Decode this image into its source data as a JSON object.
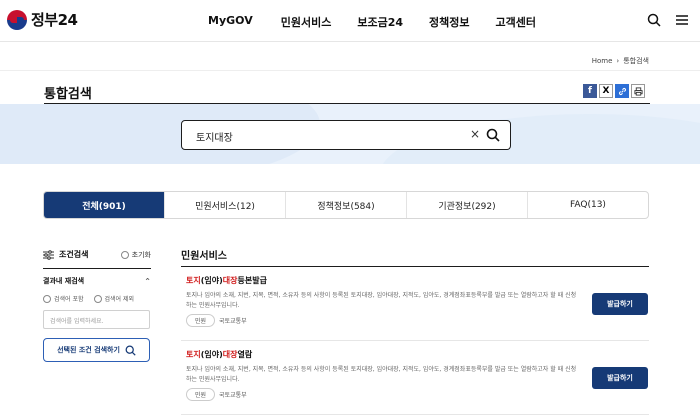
{
  "header": {
    "logo_text": "정부24",
    "nav": [
      "MyGOV",
      "민원서비스",
      "보조금24",
      "정책정보",
      "고객센터"
    ],
    "icons": [
      "search-icon",
      "menu-icon"
    ]
  },
  "breadcrumb": {
    "home": "Home",
    "current": "통합검색"
  },
  "page": {
    "title": "통합검색"
  },
  "share": {
    "facebook": "f",
    "x": "X",
    "link": "🔗",
    "print": "⎙"
  },
  "search": {
    "value": "토지대장",
    "clear": "×"
  },
  "tabs": [
    {
      "label": "전체(901)"
    },
    {
      "label": "민원서비스(12)"
    },
    {
      "label": "정책정보(584)"
    },
    {
      "label": "기관정보(292)"
    },
    {
      "label": "FAQ(13)"
    }
  ],
  "sidebar": {
    "title": "조건검색",
    "reset": "초기화",
    "within_title": "결과내 재검색",
    "radio_include": "검색어 포함",
    "radio_exclude": "검색어 제외",
    "input_placeholder": "검색어를 입력하세요.",
    "apply_button": "선택된 조건 검색하기"
  },
  "results": {
    "section_title": "민원서비스",
    "items": [
      {
        "title_hl1": "토지",
        "title_p1": "(임야)",
        "title_hl2": "대장",
        "title_rest": "등본발급",
        "desc": "토지나 임야의 소재, 지번, 지목, 면적, 소유자 등의 사항이 등록된 토지대장, 임야대장, 지적도, 임야도, 경계점좌표등록부를 발급 또는 열람하고자 할 때 신청하는 민원사무입니다.",
        "tag": "민원",
        "org": "국토교통부",
        "button": "발급하기"
      },
      {
        "title_hl1": "토지",
        "title_p1": "(임야)",
        "title_hl2": "대장",
        "title_rest": "열람",
        "desc": "토지나 임야의 소재, 지번, 지목, 면적, 소유자 등의 사항이 등록된 토지대장, 임야대장, 지적도, 임야도, 경계점좌표등록부를 발급 또는 열람하고자 할 때 신청하는 민원사무입니다.",
        "tag": "민원",
        "org": "국토교통부",
        "button": "발급하기"
      }
    ]
  },
  "colors": {
    "primary": "#163a76",
    "highlight": "#d11d1d",
    "band": "#e9f1fb"
  }
}
